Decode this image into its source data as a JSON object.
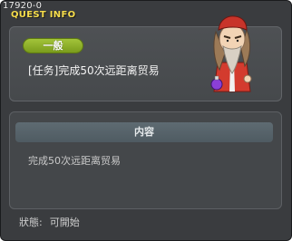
{
  "window": {
    "id_text": "17920-0",
    "title": "QUEST INFO"
  },
  "quest": {
    "category_badge": "一般",
    "name": "[任务]完成50次远距离贸易",
    "npc_icon": "npc-wizard-portrait"
  },
  "content": {
    "header": "内容",
    "text": "完成50次远距离贸易"
  },
  "status": {
    "label": "狀態:",
    "value": "可開始"
  },
  "colors": {
    "title": "#f6dd4b",
    "badge": "#8fb02a",
    "window_bg": "#3a3c3f"
  }
}
